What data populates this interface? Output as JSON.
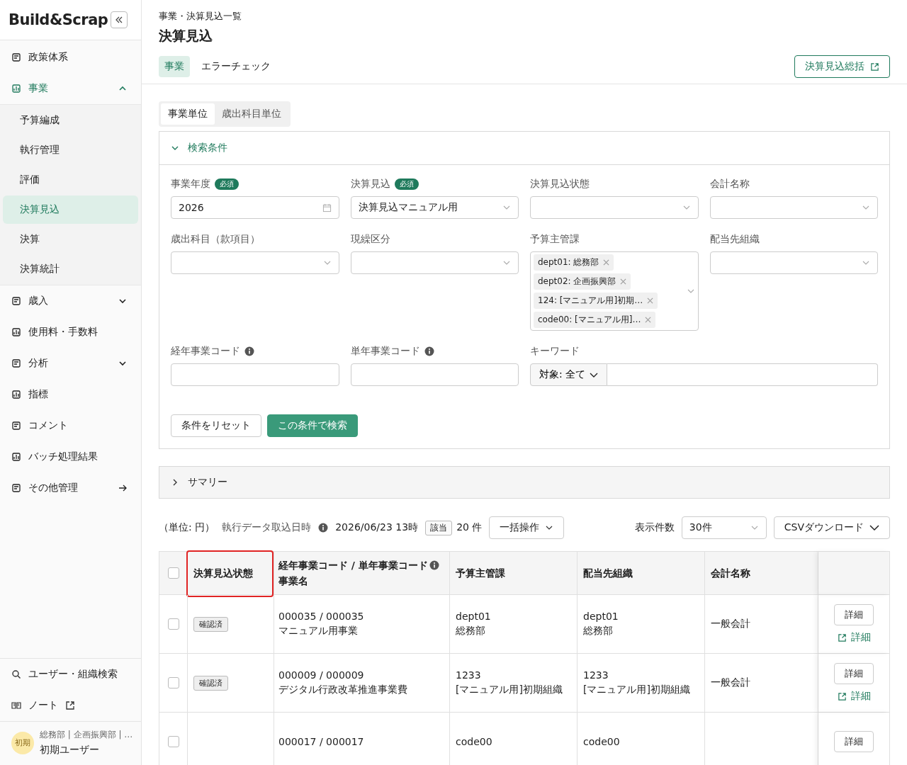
{
  "sidebar": {
    "logo": "Build&Scrap",
    "nav": [
      {
        "label": "政策体系",
        "kind": "plain",
        "selected": false
      },
      {
        "label": "事業",
        "kind": "group",
        "expanded": true,
        "selected": true,
        "children": [
          {
            "label": "予算編成",
            "selected": false
          },
          {
            "label": "執行管理",
            "selected": false
          },
          {
            "label": "評価",
            "selected": false
          },
          {
            "label": "決算見込",
            "selected": true
          },
          {
            "label": "決算",
            "selected": false
          },
          {
            "label": "決算統計",
            "selected": false
          }
        ]
      },
      {
        "label": "歳入",
        "kind": "group",
        "expanded": false,
        "selected": false
      },
      {
        "label": "使用料・手数料",
        "kind": "plain",
        "selected": false
      },
      {
        "label": "分析",
        "kind": "group",
        "expanded": false,
        "selected": false
      },
      {
        "label": "指標",
        "kind": "plain",
        "selected": false
      },
      {
        "label": "コメント",
        "kind": "plain",
        "selected": false
      },
      {
        "label": "バッチ処理結果",
        "kind": "plain",
        "selected": false
      },
      {
        "label": "その他管理",
        "kind": "link",
        "selected": false
      }
    ],
    "bottom_links": [
      {
        "label": "ユーザー・組織検索",
        "external": false
      },
      {
        "label": "ノート",
        "external": true
      }
    ],
    "user": {
      "avatar": "初期",
      "orgs": "総務部 | 企画振興部 | …",
      "name": "初期ユーザー"
    }
  },
  "header": {
    "breadcrumb": "事業・決算見込一覧",
    "title": "決算見込",
    "tabs": [
      {
        "label": "事業",
        "selected": true
      },
      {
        "label": "エラーチェック",
        "selected": false
      }
    ],
    "action_button": "決算見込総括"
  },
  "unit_tabs": [
    {
      "label": "事業単位",
      "selected": true
    },
    {
      "label": "歳出科目単位",
      "selected": false
    }
  ],
  "search": {
    "title": "検索条件",
    "expanded": true,
    "fields": [
      {
        "label": "事業年度",
        "badge": "必須",
        "info": false,
        "kind": "date",
        "value": "2026"
      },
      {
        "label": "決算見込",
        "badge": "必須",
        "info": false,
        "kind": "select",
        "value": "決算見込マニュアル用"
      },
      {
        "label": "決算見込状態",
        "info": false,
        "kind": "select"
      },
      {
        "label": "会計名称",
        "info": false,
        "kind": "select"
      },
      {
        "label": "歳出科目（款項目）",
        "info": false,
        "kind": "select"
      },
      {
        "label": "現繰区分",
        "info": false,
        "kind": "select"
      },
      {
        "label": "予算主管課",
        "info": false,
        "kind": "multiselect",
        "tags": [
          "dept01: 総務部",
          "dept02: 企画振興部",
          "124: [マニュアル用]初期…",
          "code00: [マニュアル用]…"
        ]
      },
      {
        "label": "配当先組織",
        "info": false,
        "kind": "select"
      },
      {
        "label": "経年事業コード",
        "info": true,
        "kind": "text"
      },
      {
        "label": "単年事業コード",
        "info": true,
        "kind": "text"
      },
      {
        "label": "キーワード",
        "info": false,
        "kind": "keyword",
        "target": "対象: 全て"
      }
    ],
    "reset_button": "条件をリセット",
    "search_button": "この条件で検索"
  },
  "summary": {
    "title": "サマリー",
    "expanded": false
  },
  "toolbar": {
    "unit": "（単位: 円）",
    "import_label": "執行データ取込日時",
    "import_date": "2026/06/23 13時",
    "match_badge": "該当",
    "count": "20 件",
    "bulk_button": "一括操作",
    "page_size_label": "表示件数",
    "page_size": "30件",
    "csv_button": "CSVダウンロード"
  },
  "table": {
    "select_all": {
      "checked": false
    },
    "columns": [
      {
        "label": "決算見込状態",
        "highlighted": true,
        "info": false
      },
      {
        "label": "経年事業コード / 単年事業コード",
        "sub": "事業名",
        "highlighted": false,
        "info": true
      },
      {
        "label": "予算主管課",
        "highlighted": false,
        "info": false
      },
      {
        "label": "配当先組織",
        "highlighted": false,
        "info": false
      },
      {
        "label": "会計名称",
        "highlighted": false,
        "info": false
      }
    ],
    "rows": [
      {
        "checked": false,
        "status": "確認済",
        "code": "000035 / 000035",
        "name": "マニュアル用事業",
        "dept_code": "dept01",
        "dept_name": "総務部",
        "org_code": "dept01",
        "org_name": "総務部",
        "account": "一般会計",
        "detail_button": "詳細",
        "detail_link": "詳細"
      },
      {
        "checked": false,
        "status": "確認済",
        "code": "000009 / 000009",
        "name": "デジタル行政改革推進事業費",
        "dept_code": "1233",
        "dept_name": "[マニュアル用]初期組織",
        "org_code": "1233",
        "org_name": "[マニュアル用]初期組織",
        "account": "一般会計",
        "detail_button": "詳細",
        "detail_link": "詳細"
      },
      {
        "checked": false,
        "code": "000017 / 000017",
        "dept_code": "code00",
        "org_code": "code00",
        "detail_button": "詳細"
      }
    ]
  }
}
